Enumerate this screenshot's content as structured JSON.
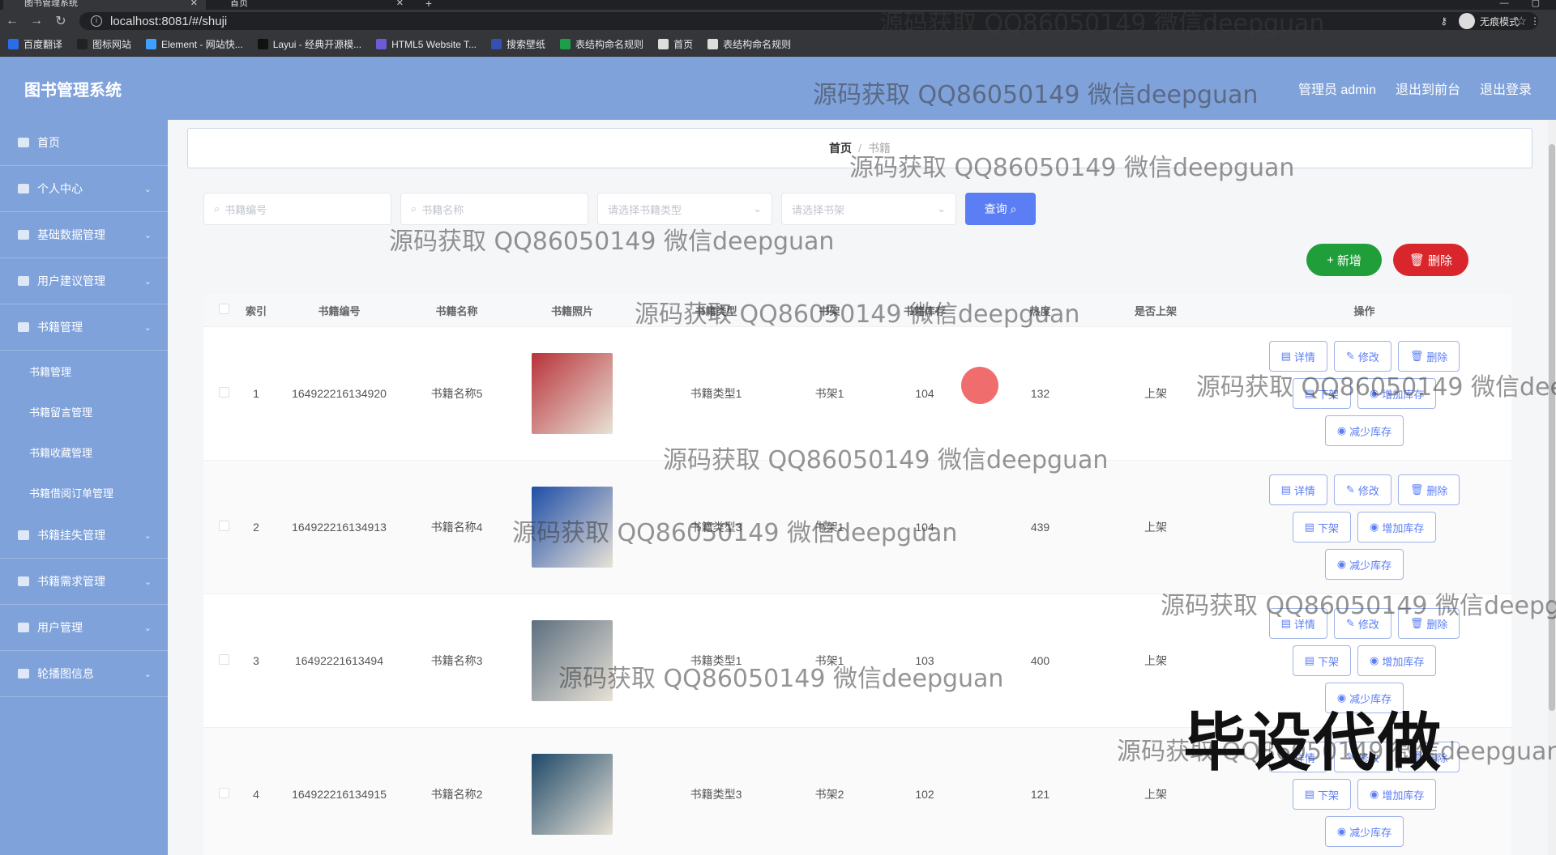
{
  "browser": {
    "tabs": [
      {
        "label": "图书管理系统",
        "active": true
      },
      {
        "label": "首页",
        "active": false
      }
    ],
    "url": "localhost:8081/#/shuji",
    "incognito_label": "无痕模式",
    "bookmarks": [
      {
        "label": "百度翻译",
        "color": "#2b6de8"
      },
      {
        "label": "图标网站",
        "color": "#222222"
      },
      {
        "label": "Element - 网站快...",
        "color": "#3fa0ff"
      },
      {
        "label": "Layui - 经典开源模...",
        "color": "#111111"
      },
      {
        "label": "HTML5 Website T...",
        "color": "#6b5bd6"
      },
      {
        "label": "搜索壁纸",
        "color": "#3451b2"
      },
      {
        "label": "表结构命名规则",
        "color": "#1e9e4a"
      },
      {
        "label": "首页",
        "color": "#dddddd"
      },
      {
        "label": "表结构命名规则",
        "color": "#dddddd"
      }
    ]
  },
  "header": {
    "title": "图书管理系统",
    "links": [
      "管理员 admin",
      "退出到前台",
      "退出登录"
    ]
  },
  "sidebar": {
    "items": [
      {
        "label": "首页",
        "has_chevron": false
      },
      {
        "label": "个人中心",
        "has_chevron": true
      },
      {
        "label": "基础数据管理",
        "has_chevron": true
      },
      {
        "label": "用户建议管理",
        "has_chevron": true
      },
      {
        "label": "书籍管理",
        "has_chevron": true
      }
    ],
    "subitems": [
      "书籍管理",
      "书籍留言管理",
      "书籍收藏管理",
      "书籍借阅订单管理"
    ],
    "items_after": [
      {
        "label": "书籍挂失管理",
        "has_chevron": true
      },
      {
        "label": "书籍需求管理",
        "has_chevron": true
      },
      {
        "label": "用户管理",
        "has_chevron": true
      },
      {
        "label": "轮播图信息",
        "has_chevron": true
      }
    ]
  },
  "breadcrumb": {
    "home": "首页",
    "separator": "/",
    "current": "书籍"
  },
  "search": {
    "book_no_placeholder": "书籍编号",
    "book_name_placeholder": "书籍名称",
    "type_placeholder": "请选择书籍类型",
    "shelf_placeholder": "请选择书架",
    "query_label": "查询"
  },
  "actions": {
    "add_label": "新增",
    "delete_label": "删除"
  },
  "table": {
    "headers": [
      "索引",
      "书籍编号",
      "书籍名称",
      "书籍照片",
      "书籍类型",
      "书架",
      "书籍库存",
      "热度",
      "是否上架",
      "操作"
    ],
    "rows": [
      {
        "index": "1",
        "no": "164922216134920",
        "name": "书籍名称5",
        "type": "书籍类型1",
        "shelf": "书架1",
        "stock": "104",
        "heat": "132",
        "status": "上架",
        "img_color": "#b8323a"
      },
      {
        "index": "2",
        "no": "164922216134913",
        "name": "书籍名称4",
        "type": "书籍类型3",
        "shelf": "书架1",
        "stock": "104",
        "heat": "439",
        "status": "上架",
        "img_color": "#1f4ea8"
      },
      {
        "index": "3",
        "no": "16492221613494",
        "name": "书籍名称3",
        "type": "书籍类型1",
        "shelf": "书架1",
        "stock": "103",
        "heat": "400",
        "status": "上架",
        "img_color": "#5d6f80"
      },
      {
        "index": "4",
        "no": "164922216134915",
        "name": "书籍名称2",
        "type": "书籍类型3",
        "shelf": "书架2",
        "stock": "102",
        "heat": "121",
        "status": "上架",
        "img_color": "#1e4868"
      }
    ],
    "ops": {
      "detail": "详情",
      "edit": "修改",
      "delete": "删除",
      "off_shelf": "下架",
      "add_stock": "增加库存",
      "reduce_stock": "减少库存"
    }
  },
  "watermark": {
    "text": "源码获取 QQ86050149 微信deepguan",
    "stamp": "毕设代做"
  }
}
